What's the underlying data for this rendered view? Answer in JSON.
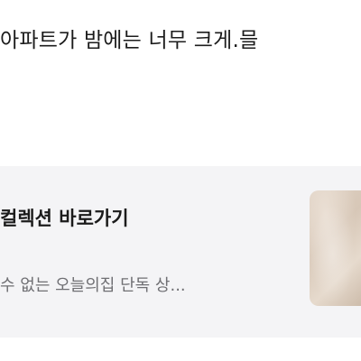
{
  "article": {
    "body_text": "아파트가 밤에는 너무 크게.믈"
  },
  "promo_card": {
    "title": "컬렉션 바로가기",
    "description": "수 없는 오늘의집 단독 상..."
  }
}
